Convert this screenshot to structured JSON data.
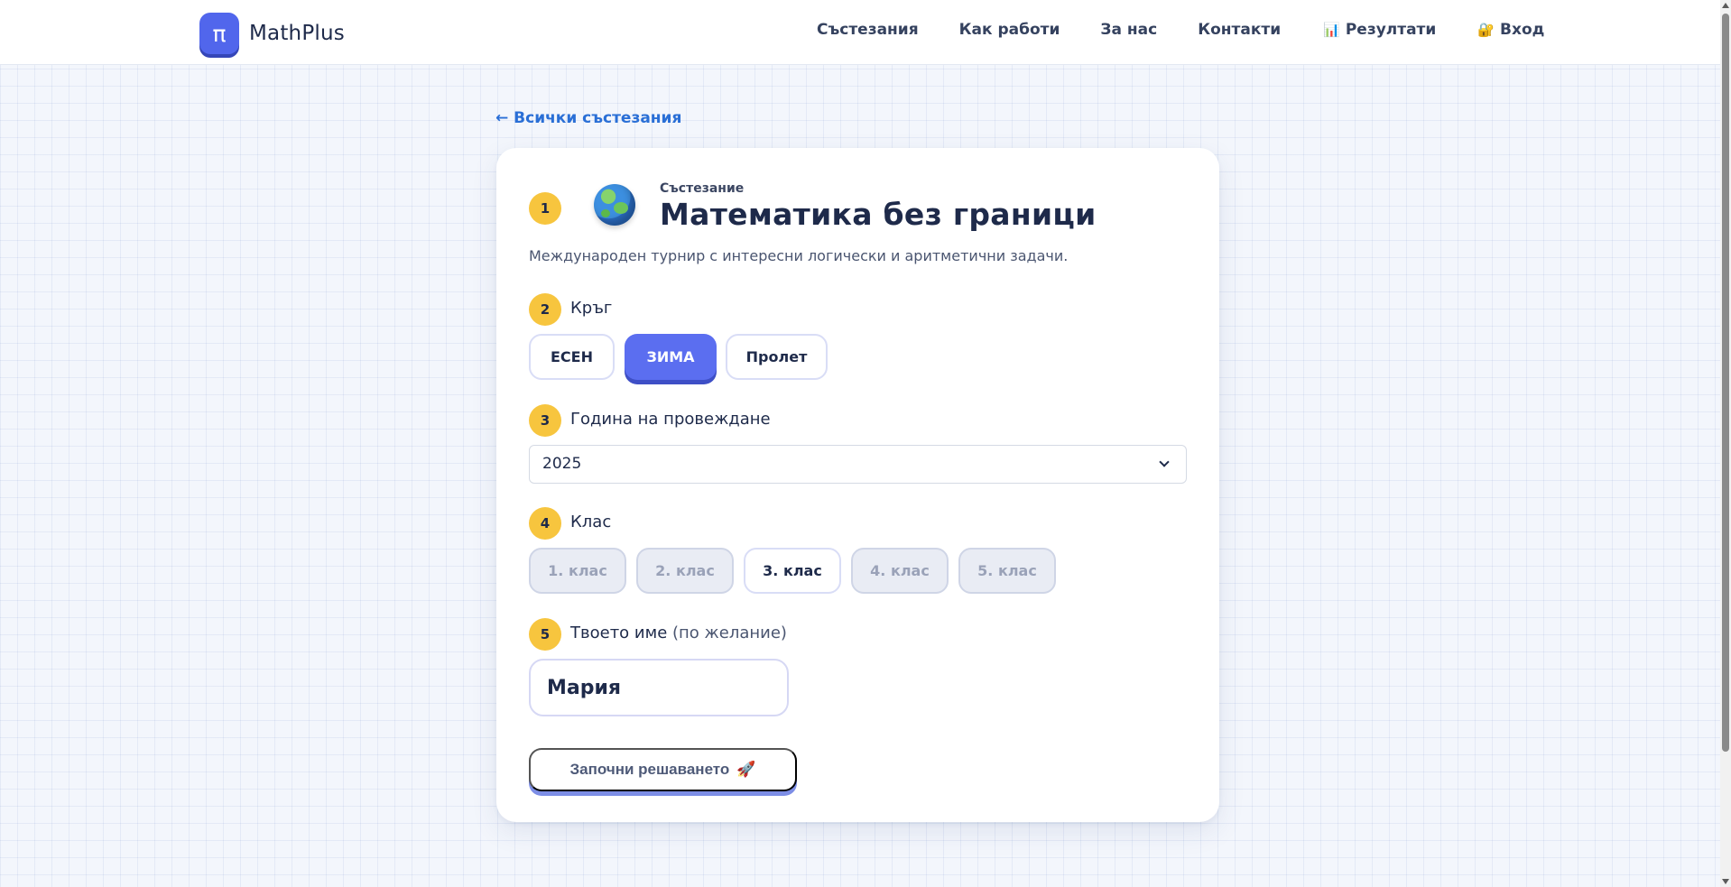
{
  "app": {
    "logo_symbol": "π",
    "name": "MathPlus"
  },
  "nav": [
    {
      "label": "Състезания",
      "icon": ""
    },
    {
      "label": "Как работи",
      "icon": ""
    },
    {
      "label": "За нас",
      "icon": ""
    },
    {
      "label": "Контакти",
      "icon": ""
    },
    {
      "label": "Резултати",
      "icon": "📊"
    },
    {
      "label": "Вход",
      "icon": "🔐"
    }
  ],
  "back_link": "← Всички състезания",
  "competition": {
    "step": "1",
    "label": "Състезание",
    "title": "Математика без граници",
    "description": "Международен турнир с интересни логически и аритметични задачи."
  },
  "round": {
    "step": "2",
    "label": "Кръг",
    "options": [
      {
        "label": "ЕСЕН",
        "selected": false
      },
      {
        "label": "ЗИМА",
        "selected": true
      },
      {
        "label": "Пролет",
        "selected": false
      }
    ]
  },
  "year": {
    "step": "3",
    "label": "Година на провеждане",
    "value": "2025"
  },
  "grade": {
    "step": "4",
    "label": "Клас",
    "options": [
      {
        "label": "1. клас",
        "selected": false
      },
      {
        "label": "2. клас",
        "selected": false
      },
      {
        "label": "3. клас",
        "selected": true
      },
      {
        "label": "4. клас",
        "selected": false
      },
      {
        "label": "5. клас",
        "selected": false
      }
    ]
  },
  "name": {
    "step": "5",
    "label": "Твоето име",
    "optional": "(по желание)",
    "value": "Мария"
  },
  "start_button": {
    "label": "Започни решаването",
    "icon": "🚀"
  },
  "colors": {
    "accent": "#5b6ef0",
    "step_badge": "#f7c53e",
    "link": "#2a6fd6"
  }
}
